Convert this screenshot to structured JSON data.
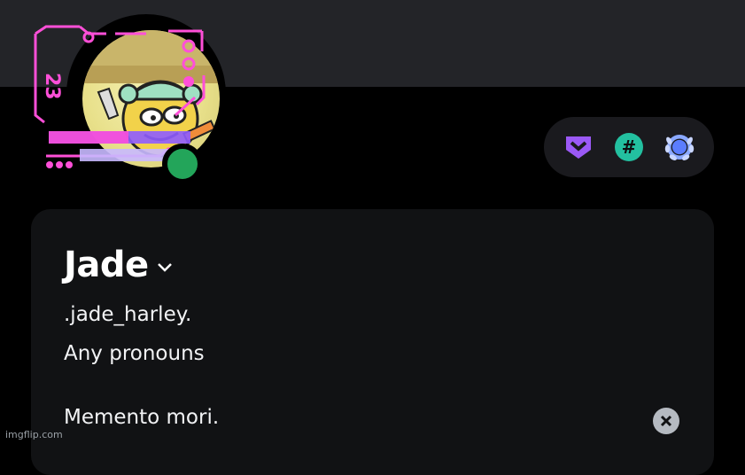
{
  "profile": {
    "display_name": "Jade",
    "username": ".jade_harley.",
    "pronouns": "Any pronouns",
    "bio": "Memento mori.",
    "status": "online"
  },
  "badges": [
    {
      "icon": "hypesquad-bravery-icon",
      "color": "#9b59f6"
    },
    {
      "icon": "hashtag-badge-icon",
      "color": "#23c0a0"
    },
    {
      "icon": "laurel-quest-badge-icon",
      "color": "#8aa8ff"
    }
  ],
  "colors": {
    "banner": "#232428",
    "card": "#111214",
    "online": "#23a55a",
    "decoration_pink": "#ff4fd8"
  },
  "watermark": "imgflip.com"
}
